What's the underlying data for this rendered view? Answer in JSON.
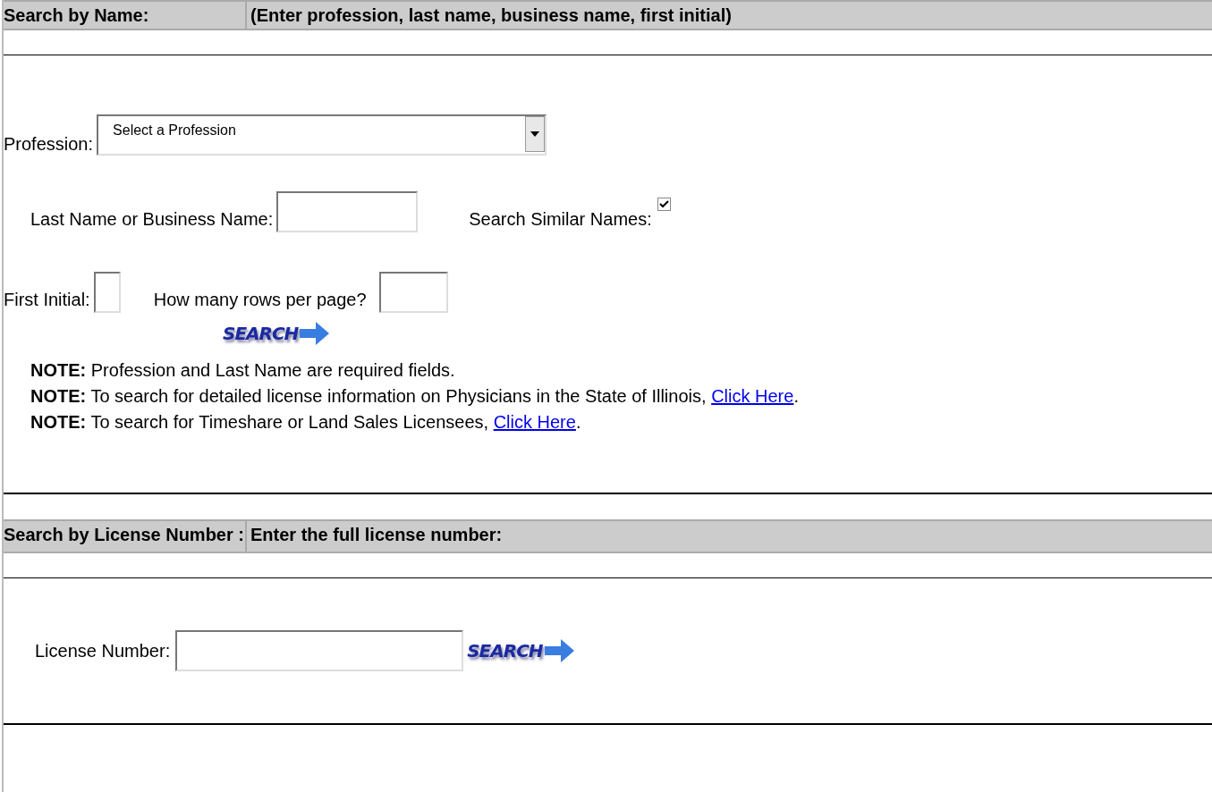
{
  "name_section": {
    "header_title": "Search by Name:",
    "header_hint": "(Enter profession, last name, business name, first initial)",
    "profession": {
      "label": "Profession:",
      "value": "Select a Profession"
    },
    "last_name": {
      "label": "Last Name or Business Name:"
    },
    "similar": {
      "label": "Search Similar Names:",
      "checked": true
    },
    "first_initial": {
      "label": "First Initial:"
    },
    "rows_per_page": {
      "label": "How many rows per page?"
    },
    "search_button": "SEARCH",
    "notes": [
      {
        "text": "**NOTE:** Profession and Last Name are required fields."
      },
      {
        "text": "**NOTE:** To search for detailed license information on Physicians in the State of Illinois,",
        "link": "Click Here",
        "tail": "."
      },
      {
        "text": "**NOTE:** To search for Timeshare or Land Sales Licensees,",
        "link": "Click Here",
        "tail": "."
      }
    ]
  },
  "license_section": {
    "header_title": "Search by License Number :",
    "header_hint": "Enter the full license number:",
    "license_number": {
      "label": "License Number:"
    },
    "search_button": "SEARCH"
  }
}
